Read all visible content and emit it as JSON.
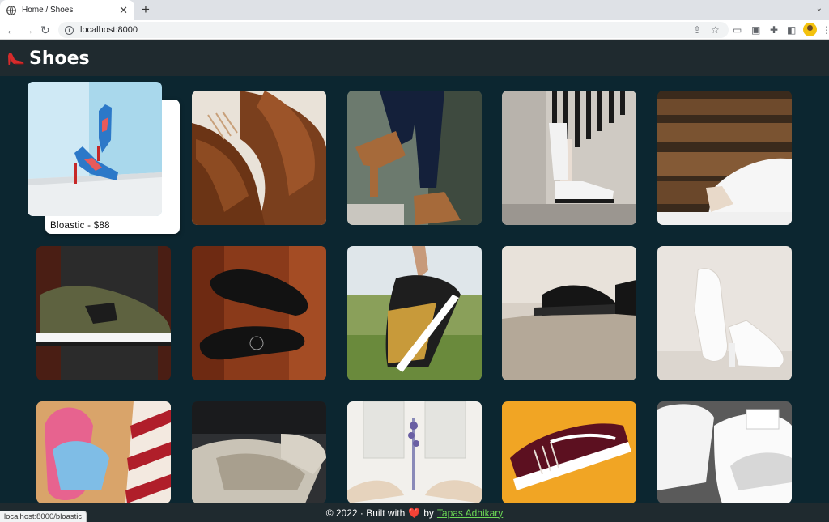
{
  "browser": {
    "tab_title": "Home / Shoes",
    "address": "localhost:8000",
    "status_url": "localhost:8000/bloastic"
  },
  "header": {
    "logo": "high-heel-shoe-icon",
    "title": "Shoes"
  },
  "products": [
    {
      "name": "Bloastic",
      "price": "$88",
      "label": "Bloastic - $88",
      "image": "blue floral high heels in a corner"
    },
    {
      "image": "brown leather oxford shoes close-up"
    },
    {
      "image": "brown ankle boots walking"
    },
    {
      "image": "white platform sneakers against concrete wall"
    },
    {
      "image": "bride shoes on wooden bench"
    },
    {
      "image": "olive New Balance sneaker"
    },
    {
      "image": "black leather shoes on red wood"
    },
    {
      "image": "running sneakers held over grass"
    },
    {
      "image": "black oxford shoes on floor"
    },
    {
      "image": "white strap heels"
    },
    {
      "image": "pink flip-flops with striped towel"
    },
    {
      "image": "glitter silver heels"
    },
    {
      "image": "beige heels with lavender vase"
    },
    {
      "image": "maroon sneaker on yellow background"
    },
    {
      "image": "white clogs with tags"
    }
  ],
  "footer": {
    "prefix": "© 2022 · Built with",
    "heart": "❤️",
    "by": "by",
    "author": "Tapas Adhikary"
  },
  "colors": {
    "page_bg": "#0c2630",
    "header_bg": "#1f2a2f",
    "author_link": "#6cda55"
  }
}
